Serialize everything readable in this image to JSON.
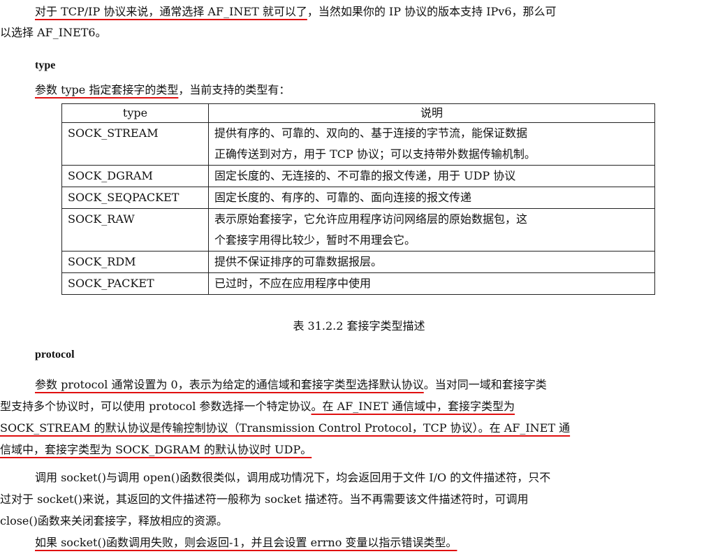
{
  "intro": {
    "line1_a": "对于 TCP/IP 协议来说，通常选择 AF_INET 就可以了",
    "line1_b": "，当然如果你的 IP 协议的版本支持 IPv6，那么可",
    "line2": "以选择 AF_INET6。"
  },
  "type_section": {
    "heading": "type",
    "lead_a": "参数 type 指定套接字的类型",
    "lead_b": "，当前支持的类型有："
  },
  "type_table": {
    "headers": [
      "type",
      "说明"
    ],
    "rows": [
      {
        "type": "SOCK_STREAM",
        "desc_1": "提供有序的、可靠的、双向的、基于连接的字节流，能保证数据",
        "desc_2": "正确传送到对方，用于 TCP 协议；可以支持带外数据传输机制。"
      },
      {
        "type": "SOCK_DGRAM",
        "desc_1": "固定长度的、无连接的、不可靠的报文传递，用于 UDP 协议"
      },
      {
        "type": "SOCK_SEQPACKET",
        "desc_1": "固定长度的、有序的、可靠的、面向连接的报文传递"
      },
      {
        "type": "SOCK_RAW",
        "desc_1": "表示原始套接字，它允许应用程序访问网络层的原始数据包，这",
        "desc_2": "个套接字用得比较少，暂时不用理会它。"
      },
      {
        "type": "SOCK_RDM",
        "desc_1": "提供不保证排序的可靠数据报层。"
      },
      {
        "type": "SOCK_PACKET",
        "desc_1": "已过时，不应在应用程序中使用"
      }
    ],
    "caption": "表  31.2.2  套接字类型描述"
  },
  "protocol_section": {
    "heading": "protocol",
    "p1_l1_a": "参数 protocol 通常设置为 0，表示为给定的通信域和套接字类型选择默认协议",
    "p1_l1_b": "。当对同一域和套接字类",
    "p1_l2_a": "型支持多个协议时，可以使用  protocol  参数选择一个特定协议",
    "p1_l2_b": "。在  AF_INET  通信域中，套接字类型为",
    "p1_l3_a": "SOCK_STREAM 的默认协议是传输控制协议（Transmission Control Protocol，TCP 协议）",
    "p1_l3_b": "。在 AF_INET 通",
    "p1_l4": "信域中，套接字类型为 SOCK_DGRAM 的默认协议时 UDP。",
    "p2_l1": "调用 socket()与调用 open()函数很类似，调用成功情况下，均会返回用于文件 I/O 的文件描述符，只不",
    "p2_l2": "过对于  socket()来说，其返回的文件描述符一般称为  socket  描述符。当不再需要该文件描述符时，可调用",
    "p2_l3": "close()函数来关闭套接字，释放相应的资源。",
    "p3": "如果 socket()函数调用失败，则会返回-1，并且会设置 errno 变量以指示错误类型。"
  }
}
